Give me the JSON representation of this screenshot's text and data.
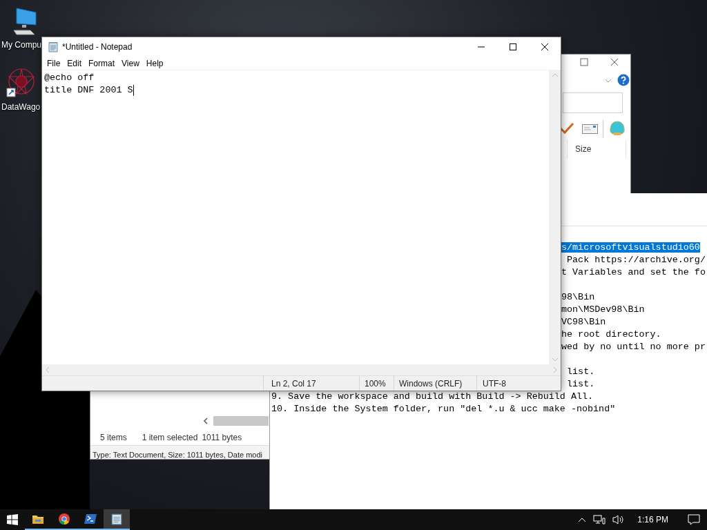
{
  "desktop_icons": [
    {
      "kind": "computer",
      "label": "My Compu"
    },
    {
      "kind": "shortcut",
      "label": "DataWago"
    }
  ],
  "explorer": {
    "column": "Size",
    "item_count": "5 items",
    "selection": "1 item selected",
    "selection_size": "1011 bytes",
    "details": "Type: Text Document, Size: 1011 bytes, Date modi"
  },
  "text_window": {
    "lines": [
      {
        "kind": "fragment",
        "selected_text": "s/microsoftvisualstudio60"
      },
      {
        "kind": "fragment",
        "text": " Pack https://archive.org/"
      },
      {
        "kind": "fragment",
        "text": "t Variables and set the fo"
      },
      {
        "kind": "blank"
      },
      {
        "kind": "fragment",
        "text": "98\\Bin"
      },
      {
        "kind": "fragment",
        "text": "mon\\MSDev98\\Bin"
      },
      {
        "kind": "fragment",
        "text": "VC98\\Bin"
      },
      {
        "kind": "fragment",
        "text": "he root directory."
      },
      {
        "kind": "fragment",
        "text": "wed by no until no more pr"
      },
      {
        "kind": "blank"
      },
      {
        "kind": "fragment",
        "text": " list."
      },
      {
        "kind": "fragment",
        "text": " list."
      },
      {
        "kind": "full",
        "text": "9. Save the workspace and build with Build -> Rebuild All."
      },
      {
        "kind": "full",
        "text": "10. Inside the System folder, run \"del *.u & ucc make -nobind\""
      }
    ]
  },
  "notepad": {
    "title": "*Untitled - Notepad",
    "menu": [
      "File",
      "Edit",
      "Format",
      "View",
      "Help"
    ],
    "lines": [
      "@echo off",
      "title DNF 2001 S"
    ],
    "status": {
      "position": "Ln 2, Col 17",
      "zoom": "100%",
      "line_ending": "Windows (CRLF)",
      "encoding": "UTF-8"
    }
  },
  "taskbar": {
    "apps": [
      {
        "kind": "folder",
        "active": false
      },
      {
        "kind": "browser",
        "active": false
      },
      {
        "kind": "terminal",
        "active": false
      },
      {
        "kind": "notepad",
        "active": true
      }
    ],
    "clock": "1:16 PM"
  }
}
